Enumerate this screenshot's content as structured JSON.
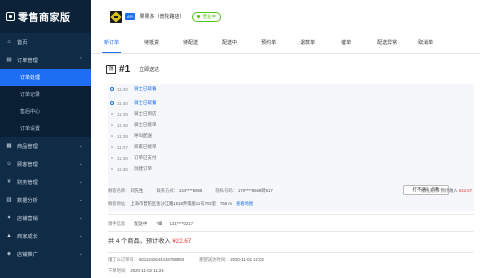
{
  "app": {
    "title": "零售商家版"
  },
  "colors": {
    "sidebar_bg": "#0f2b46",
    "accent": "#1d6ef2",
    "price": "#e53935",
    "open": "#52c41a"
  },
  "sidebar": {
    "items": [
      {
        "label": "首页",
        "icon": "home-icon"
      },
      {
        "label": "订单管理",
        "icon": "order-icon",
        "expanded": true
      },
      {
        "label": "商品管理",
        "icon": "goods-icon"
      },
      {
        "label": "顾客管理",
        "icon": "customer-icon"
      },
      {
        "label": "财务管理",
        "icon": "finance-icon"
      },
      {
        "label": "数据分析",
        "icon": "chart-icon"
      },
      {
        "label": "店铺营销",
        "icon": "marketing-icon"
      },
      {
        "label": "商家成长",
        "icon": "growth-icon"
      },
      {
        "label": "店铺推广",
        "icon": "promo-icon"
      }
    ],
    "order_sub": [
      {
        "label": "订单处理",
        "active": true
      },
      {
        "label": "订单记录"
      },
      {
        "label": "售后中心"
      },
      {
        "label": "订单设置"
      }
    ]
  },
  "topbar": {
    "api_tag": "API",
    "shop_name": "果果多（普陀路店）",
    "status": "营业中"
  },
  "tabs": [
    "新订单",
    "待抵货",
    "待配送",
    "配送中",
    "预约单",
    "退款单",
    "催单",
    "配送异常",
    "取消单"
  ],
  "order": {
    "badge": "饿",
    "number": "#1",
    "type": "立即送达",
    "timeline": [
      {
        "time": "11:40",
        "event": "骑士已取餐",
        "highlight": true
      },
      {
        "time": "11:40",
        "event": "骑士已取餐"
      },
      {
        "time": "11:39",
        "event": "骑士已到店"
      },
      {
        "time": "11:38",
        "event": "骑士已接单"
      },
      {
        "time": "11:38",
        "event": "呼叫配送"
      },
      {
        "time": "11:37",
        "event": "商家已接单"
      },
      {
        "time": "11:36",
        "event": "订单已支付"
      },
      {
        "time": "11:36",
        "event": "创建订单"
      }
    ],
    "customer": {
      "name_label": "顾客名称:",
      "name": "刘先生",
      "phone_label": "联系方式:",
      "phone": "134****6965",
      "virtual_label": "隐私号码:",
      "virtual": "170****9569转617",
      "hint_button": "打不通？点我",
      "pay_label": "在线支付:",
      "pay_text": "预计收入",
      "pay_amount": "¥22.67",
      "address_label": "顾客地址:",
      "address": "上海市普陀区金沙江路1518弄南座11号702室",
      "distance": "756 m",
      "map_link": "查看地图"
    },
    "delivery": {
      "label": "骑手信息",
      "status": "配送中",
      "rider_label": "*峰",
      "rider_phone": "131****0217"
    },
    "summary": {
      "prefix": "共 4 个商品，预计收入",
      "amount": "¥22.67"
    },
    "meta": {
      "order_no_label": "饿了么订单号:",
      "order_no": "5011342644415788893",
      "expect_label": "期望送达时间:",
      "expect_time": "2020-11-02 12:02",
      "create_label": "下单时间:",
      "create_time": "2020-11-02 11:24"
    }
  }
}
